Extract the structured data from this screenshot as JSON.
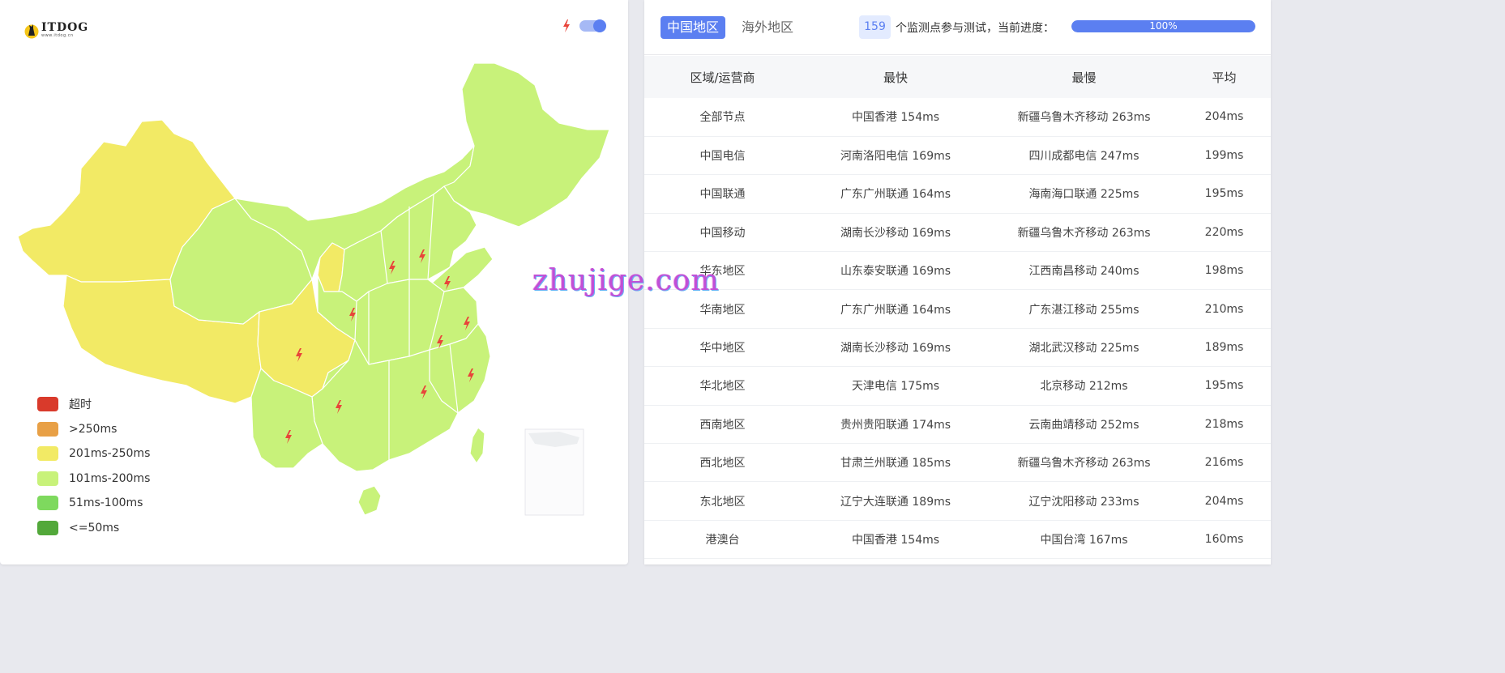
{
  "logo": {
    "main": "ITDOG",
    "sub": "www.itdog.cn"
  },
  "map": {
    "toggle_on": true,
    "colors": {
      "timeout": "#d93a2b",
      "over250": "#e8a046",
      "r201_250": "#f2ea65",
      "r101_200": "#c8f27a",
      "r51_100": "#7ed95e",
      "le50": "#52a83a",
      "bolt": "#e8443a"
    },
    "legend": [
      {
        "label": "超时",
        "color": "#d93a2b"
      },
      {
        "label": ">250ms",
        "color": "#e8a046"
      },
      {
        "label": "201ms-250ms",
        "color": "#f2ea65"
      },
      {
        "label": "101ms-200ms",
        "color": "#c8f27a"
      },
      {
        "label": "51ms-100ms",
        "color": "#7ed95e"
      },
      {
        "label": "<=50ms",
        "color": "#52a83a"
      }
    ]
  },
  "panel": {
    "tabs": [
      {
        "label": "中国地区",
        "active": true
      },
      {
        "label": "海外地区",
        "active": false
      }
    ],
    "node_count": "159",
    "progress_text": "个监测点参与测试，当前进度：",
    "progress_value": "100%",
    "progress_fraction": 1.0,
    "accent_color": "#5b7ff1"
  },
  "table": {
    "headers": [
      "区域/运营商",
      "最快",
      "最慢",
      "平均"
    ],
    "rows": [
      [
        "全部节点",
        "中国香港 154ms",
        "新疆乌鲁木齐移动 263ms",
        "204ms"
      ],
      [
        "中国电信",
        "河南洛阳电信 169ms",
        "四川成都电信 247ms",
        "199ms"
      ],
      [
        "中国联通",
        "广东广州联通 164ms",
        "海南海口联通 225ms",
        "195ms"
      ],
      [
        "中国移动",
        "湖南长沙移动 169ms",
        "新疆乌鲁木齐移动 263ms",
        "220ms"
      ],
      [
        "华东地区",
        "山东泰安联通 169ms",
        "江西南昌移动 240ms",
        "198ms"
      ],
      [
        "华南地区",
        "广东广州联通 164ms",
        "广东湛江移动 255ms",
        "210ms"
      ],
      [
        "华中地区",
        "湖南长沙移动 169ms",
        "湖北武汉移动 225ms",
        "189ms"
      ],
      [
        "华北地区",
        "天津电信 175ms",
        "北京移动 212ms",
        "195ms"
      ],
      [
        "西南地区",
        "贵州贵阳联通 174ms",
        "云南曲靖移动 252ms",
        "218ms"
      ],
      [
        "西北地区",
        "甘肃兰州联通 185ms",
        "新疆乌鲁木齐移动 263ms",
        "216ms"
      ],
      [
        "东北地区",
        "辽宁大连联通 189ms",
        "辽宁沈阳移动 233ms",
        "204ms"
      ],
      [
        "港澳台",
        "中国香港 154ms",
        "中国台湾 167ms",
        "160ms"
      ]
    ]
  },
  "watermark": "zhujige.com"
}
